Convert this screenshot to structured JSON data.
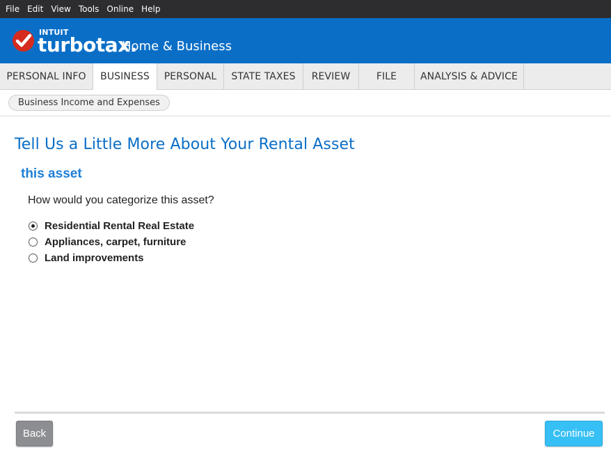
{
  "menu": [
    "File",
    "Edit",
    "View",
    "Tools",
    "Online",
    "Help"
  ],
  "brand": {
    "intuit": "INTUIT",
    "product": "turbotax.",
    "edition": "Home & Business",
    "logo_color": "#d52b1e",
    "header_color": "#0a6ec7"
  },
  "tabs": [
    {
      "label": "PERSONAL INFO",
      "active": false
    },
    {
      "label": "BUSINESS",
      "active": true
    },
    {
      "label": "PERSONAL",
      "active": false
    },
    {
      "label": "STATE TAXES",
      "active": false
    },
    {
      "label": "REVIEW",
      "active": false
    },
    {
      "label": "FILE",
      "active": false
    },
    {
      "label": "ANALYSIS & ADVICE",
      "active": false
    }
  ],
  "subnav": {
    "label": "Business Income and Expenses"
  },
  "main": {
    "title": "Tell Us a Little More About Your Rental Asset",
    "section": "this asset",
    "question": "How would you categorize this asset?",
    "options": [
      {
        "label": "Residential Rental Real Estate",
        "selected": true
      },
      {
        "label": "Appliances, carpet, furniture",
        "selected": false
      },
      {
        "label": "Land improvements",
        "selected": false
      }
    ]
  },
  "footer": {
    "back_label": "Back",
    "continue_label": "Continue",
    "continue_color": "#37c0f5",
    "back_color": "#8c8e92"
  }
}
